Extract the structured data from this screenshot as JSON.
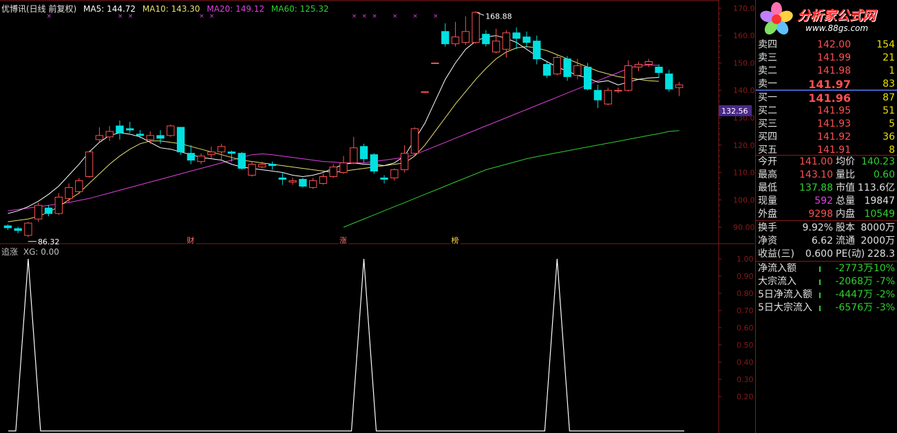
{
  "title_bar": {
    "stock": "优博讯(日线 前复权)",
    "ma5": "MA5: 144.72",
    "ma10": "MA10: 143.30",
    "ma20": "MA20: 149.12",
    "ma60": "MA60: 125.32"
  },
  "colors": {
    "up": "#ff5050",
    "down": "#00e0e0",
    "ma5": "#ffffff",
    "ma10": "#e8e070",
    "ma20": "#e040e0",
    "ma60": "#30d030",
    "grid": "#8a1a1a",
    "indicator": "#ffffff"
  },
  "price_axis": {
    "ticks": [
      "170.00",
      "160.00",
      "150.00",
      "140.00",
      "130.00",
      "120.00",
      "110.00",
      "100.00",
      "90.00"
    ]
  },
  "price_marker": "132.56",
  "high_label": "168.88",
  "low_label": "86.32",
  "event_markers": [
    {
      "label": "财"
    },
    {
      "label": "涨"
    },
    {
      "label": "榜"
    }
  ],
  "indicator": {
    "name": "追涨",
    "legend": "XG: 0.00",
    "axis_ticks": [
      "1.00",
      "0.90",
      "0.80",
      "0.70",
      "0.60",
      "0.50",
      "0.40",
      "0.30",
      "0.20"
    ],
    "signals": [
      1,
      1,
      1
    ]
  },
  "logo": {
    "text": "分析家公式网",
    "url": "www.88gs.com"
  },
  "order_book": {
    "asks": [
      {
        "label": "卖四",
        "price": "142.00",
        "vol": "154"
      },
      {
        "label": "卖三",
        "price": "141.99",
        "vol": "21"
      },
      {
        "label": "卖二",
        "price": "141.98",
        "vol": "1"
      },
      {
        "label": "卖一",
        "price": "141.97",
        "vol": "83"
      }
    ],
    "bids": [
      {
        "label": "买一",
        "price": "141.96",
        "vol": "87"
      },
      {
        "label": "买二",
        "price": "141.95",
        "vol": "51"
      },
      {
        "label": "买三",
        "price": "141.93",
        "vol": "5"
      },
      {
        "label": "买四",
        "price": "141.92",
        "vol": "36"
      },
      {
        "label": "买五",
        "price": "141.91",
        "vol": "8"
      }
    ]
  },
  "quote": [
    {
      "l1": "今开",
      "v1": "141.00",
      "c1": "#ff5050",
      "l2": "均价",
      "v2": "140.23",
      "c2": "#30d030"
    },
    {
      "l1": "最高",
      "v1": "143.10",
      "c1": "#ff5050",
      "l2": "量比",
      "v2": "0.60",
      "c2": "#30d030"
    },
    {
      "l1": "最低",
      "v1": "137.88",
      "c1": "#30d030",
      "l2": "市值",
      "v2": "113.6亿",
      "c2": "#e0e0e0"
    },
    {
      "l1": "现量",
      "v1": "592",
      "c1": "#e040e0",
      "l2": "总量",
      "v2": "19847",
      "c2": "#e0e0e0"
    },
    {
      "l1": "外盘",
      "v1": "9298",
      "c1": "#ff5050",
      "l2": "内盘",
      "v2": "10549",
      "c2": "#30d030"
    }
  ],
  "fundamentals": [
    {
      "l1": "换手",
      "v1": "9.92%",
      "l2": "股本",
      "v2": "8000万"
    },
    {
      "l1": "净资",
      "v1": "6.62",
      "l2": "流通",
      "v2": "2000万"
    },
    {
      "l1": "收益(三)",
      "v1": "0.600",
      "l2": "PE(动)",
      "v2": "228.3"
    }
  ],
  "capital_flow": [
    {
      "label": "净流入额",
      "value": "-2773万",
      "pct": "-10%"
    },
    {
      "label": "大宗流入",
      "value": "-2068万",
      "pct": "-7%"
    },
    {
      "label": "5日净流入额",
      "value": "-4447万",
      "pct": "-2%"
    },
    {
      "label": "5日大宗流入",
      "value": "-6576万",
      "pct": "-3%"
    }
  ],
  "chart_data": {
    "type": "candlestick",
    "title": "优博讯(日线 前复权)",
    "ylim": [
      86,
      173
    ],
    "candles": [
      {
        "o": 90.5,
        "c": 89.8,
        "h": 91.0,
        "l": 89.0
      },
      {
        "o": 89.5,
        "c": 88.8,
        "h": 90.2,
        "l": 87.8
      },
      {
        "o": 87.0,
        "c": 91.5,
        "h": 92.0,
        "l": 86.3
      },
      {
        "o": 93.0,
        "c": 98.0,
        "h": 99.0,
        "l": 92.0
      },
      {
        "o": 97.0,
        "c": 95.0,
        "h": 98.0,
        "l": 94.0
      },
      {
        "o": 95.0,
        "c": 101.0,
        "h": 102.5,
        "l": 94.5
      },
      {
        "o": 100.5,
        "c": 104.5,
        "h": 106.0,
        "l": 99.0
      },
      {
        "o": 103.0,
        "c": 107.0,
        "h": 108.0,
        "l": 102.0
      },
      {
        "o": 108.5,
        "c": 117.5,
        "h": 118.0,
        "l": 108.0
      },
      {
        "o": 122.0,
        "c": 123.5,
        "h": 126.5,
        "l": 121.0
      },
      {
        "o": 123.0,
        "c": 125.0,
        "h": 127.0,
        "l": 121.5
      },
      {
        "o": 127.0,
        "c": 124.5,
        "h": 129.0,
        "l": 122.0
      },
      {
        "o": 126.0,
        "c": 125.5,
        "h": 128.5,
        "l": 124.5
      },
      {
        "o": 124.0,
        "c": 123.5,
        "h": 125.5,
        "l": 122.5
      },
      {
        "o": 122.0,
        "c": 123.5,
        "h": 125.0,
        "l": 120.5
      },
      {
        "o": 123.5,
        "c": 122.5,
        "h": 125.5,
        "l": 120.5
      },
      {
        "o": 123.5,
        "c": 127.0,
        "h": 127.5,
        "l": 123.0
      },
      {
        "o": 126.5,
        "c": 117.5,
        "h": 126.5,
        "l": 116.5
      },
      {
        "o": 117.0,
        "c": 114.5,
        "h": 120.0,
        "l": 113.0
      },
      {
        "o": 114.0,
        "c": 116.0,
        "h": 117.0,
        "l": 113.0
      },
      {
        "o": 116.5,
        "c": 117.5,
        "h": 119.5,
        "l": 115.0
      },
      {
        "o": 117.5,
        "c": 119.5,
        "h": 120.5,
        "l": 114.5
      },
      {
        "o": 117.5,
        "c": 117.0,
        "h": 118.0,
        "l": 114.0
      },
      {
        "o": 117.0,
        "c": 111.5,
        "h": 117.5,
        "l": 111.0
      },
      {
        "o": 109.0,
        "c": 113.0,
        "h": 114.0,
        "l": 108.5
      },
      {
        "o": 112.0,
        "c": 113.0,
        "h": 114.0,
        "l": 111.5
      },
      {
        "o": 113.0,
        "c": 112.5,
        "h": 114.0,
        "l": 111.0
      },
      {
        "o": 108.0,
        "c": 107.5,
        "h": 110.0,
        "l": 105.5
      },
      {
        "o": 106.5,
        "c": 107.0,
        "h": 108.0,
        "l": 105.5
      },
      {
        "o": 107.5,
        "c": 105.0,
        "h": 108.0,
        "l": 104.5
      },
      {
        "o": 104.5,
        "c": 107.0,
        "h": 108.0,
        "l": 104.0
      },
      {
        "o": 106.0,
        "c": 108.5,
        "h": 109.5,
        "l": 105.5
      },
      {
        "o": 108.5,
        "c": 112.0,
        "h": 113.0,
        "l": 108.0
      },
      {
        "o": 110.0,
        "c": 113.5,
        "h": 116.0,
        "l": 109.5
      },
      {
        "o": 113.5,
        "c": 119.0,
        "h": 123.0,
        "l": 113.0
      },
      {
        "o": 119.5,
        "c": 115.0,
        "h": 120.5,
        "l": 113.5
      },
      {
        "o": 116.5,
        "c": 110.5,
        "h": 117.0,
        "l": 109.5
      },
      {
        "o": 108.0,
        "c": 107.5,
        "h": 109.0,
        "l": 106.0
      },
      {
        "o": 108.0,
        "c": 111.0,
        "h": 111.5,
        "l": 107.0
      },
      {
        "o": 111.0,
        "c": 117.0,
        "h": 120.0,
        "l": 110.0
      },
      {
        "o": 117.0,
        "c": 126.0,
        "h": 126.5,
        "l": 116.0
      },
      {
        "o": 139.5,
        "c": 139.5,
        "h": 139.7,
        "l": 139.3
      },
      {
        "o": 150.0,
        "c": 150.0,
        "h": 150.2,
        "l": 149.8
      },
      {
        "o": 161.5,
        "c": 157.0,
        "h": 164.5,
        "l": 156.0
      },
      {
        "o": 157.0,
        "c": 159.5,
        "h": 165.0,
        "l": 156.0
      },
      {
        "o": 157.5,
        "c": 161.5,
        "h": 167.0,
        "l": 156.5
      },
      {
        "o": 157.5,
        "c": 168.5,
        "h": 168.9,
        "l": 157.0
      },
      {
        "o": 160.5,
        "c": 157.0,
        "h": 162.0,
        "l": 156.0
      },
      {
        "o": 154.0,
        "c": 158.0,
        "h": 162.5,
        "l": 153.5
      },
      {
        "o": 155.0,
        "c": 161.0,
        "h": 162.0,
        "l": 152.0
      },
      {
        "o": 161.0,
        "c": 159.0,
        "h": 163.0,
        "l": 155.0
      },
      {
        "o": 159.5,
        "c": 157.5,
        "h": 161.5,
        "l": 155.5
      },
      {
        "o": 158.0,
        "c": 151.5,
        "h": 160.0,
        "l": 149.5
      },
      {
        "o": 149.5,
        "c": 145.5,
        "h": 150.5,
        "l": 144.5
      },
      {
        "o": 146.0,
        "c": 152.0,
        "h": 153.0,
        "l": 145.5
      },
      {
        "o": 151.5,
        "c": 145.0,
        "h": 152.5,
        "l": 143.5
      },
      {
        "o": 145.5,
        "c": 149.0,
        "h": 151.5,
        "l": 144.0
      },
      {
        "o": 148.5,
        "c": 140.5,
        "h": 150.0,
        "l": 140.0
      },
      {
        "o": 140.0,
        "c": 136.5,
        "h": 142.0,
        "l": 133.5
      },
      {
        "o": 135.0,
        "c": 140.0,
        "h": 141.0,
        "l": 134.5
      },
      {
        "o": 140.0,
        "c": 140.0,
        "h": 141.0,
        "l": 139.0
      },
      {
        "o": 140.0,
        "c": 149.0,
        "h": 151.0,
        "l": 139.5
      },
      {
        "o": 148.5,
        "c": 149.5,
        "h": 150.5,
        "l": 147.0
      },
      {
        "o": 149.5,
        "c": 150.5,
        "h": 151.5,
        "l": 148.5
      },
      {
        "o": 148.5,
        "c": 146.5,
        "h": 149.5,
        "l": 144.5
      },
      {
        "o": 146.0,
        "c": 140.5,
        "h": 147.5,
        "l": 139.5
      },
      {
        "o": 141.0,
        "c": 142.0,
        "h": 143.1,
        "l": 137.9
      }
    ],
    "ma5": [
      95.0,
      96.0,
      97.5,
      99.5,
      102.0,
      105.0,
      109.0,
      113.0,
      117.5,
      121.0,
      123.5,
      124.5,
      124.0,
      123.0,
      121.0,
      119.0,
      118.5,
      117.5,
      116.5,
      115.5,
      115.0,
      114.5,
      113.0,
      112.0,
      111.5,
      111.0,
      110.5,
      110.0,
      109.0,
      108.5,
      109.0,
      110.0,
      111.5,
      113.0,
      113.5,
      113.0,
      113.0,
      112.5,
      113.5,
      116.0,
      122.0,
      128.0,
      136.0,
      144.0,
      150.0,
      155.0,
      158.0,
      159.5,
      160.0,
      159.0,
      157.5,
      155.0,
      152.5,
      150.5,
      148.5,
      147.0,
      145.5,
      144.5,
      143.0,
      143.5,
      142.0,
      143.0,
      144.0,
      144.5,
      144.7
    ],
    "ma10": [
      92.0,
      92.5,
      93.0,
      94.0,
      95.5,
      97.5,
      100.0,
      102.5,
      106.0,
      109.5,
      113.0,
      116.0,
      118.5,
      120.5,
      121.5,
      121.5,
      121.0,
      120.5,
      119.5,
      118.5,
      117.5,
      116.5,
      115.5,
      114.5,
      114.0,
      113.5,
      113.0,
      112.5,
      112.0,
      111.5,
      111.0,
      110.5,
      110.0,
      110.5,
      111.0,
      111.5,
      112.0,
      112.5,
      113.0,
      113.5,
      116.0,
      120.0,
      125.0,
      130.0,
      135.0,
      139.5,
      144.0,
      148.0,
      151.5,
      154.0,
      155.5,
      156.0,
      155.5,
      154.5,
      153.0,
      151.5,
      150.0,
      148.5,
      147.0,
      146.0,
      145.0,
      144.5,
      144.0,
      143.5,
      143.3
    ],
    "ma20": [
      96.0,
      96.5,
      97.0,
      97.5,
      98.0,
      98.5,
      99.0,
      99.8,
      100.5,
      101.5,
      102.5,
      103.5,
      104.5,
      105.5,
      106.5,
      107.5,
      108.5,
      109.5,
      110.5,
      111.5,
      112.5,
      113.5,
      114.5,
      115.5,
      116.5,
      116.8,
      116.5,
      116.0,
      115.5,
      115.0,
      114.5,
      114.0,
      113.8,
      113.5,
      113.5,
      113.5,
      114.0,
      114.5,
      115.0,
      115.5,
      116.5,
      118.0,
      119.5,
      121.0,
      122.5,
      124.0,
      125.5,
      127.0,
      128.5,
      130.0,
      131.5,
      133.0,
      134.5,
      136.0,
      137.5,
      139.0,
      140.5,
      142.0,
      143.5,
      145.0,
      146.5,
      148.0,
      149.0,
      149.3,
      149.1
    ],
    "ma60": [
      90.0,
      91.5,
      93.0,
      94.5,
      96.0,
      97.5,
      99.0,
      100.5,
      102.0,
      103.5,
      105.0,
      106.5,
      108.0,
      109.5,
      111.0,
      112.0,
      113.0,
      114.0,
      115.0,
      115.8,
      116.5,
      117.2,
      117.9,
      118.6,
      119.3,
      120.0,
      120.7,
      121.4,
      122.1,
      122.8,
      123.5,
      124.2,
      125.0,
      125.3
    ]
  }
}
